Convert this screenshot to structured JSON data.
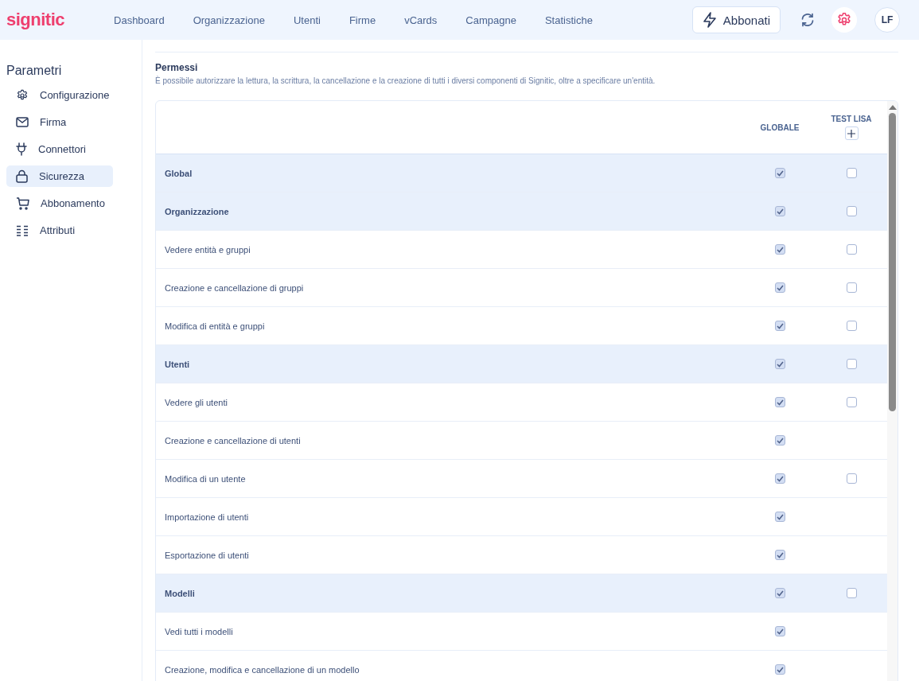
{
  "topbar": {
    "logo": "signitic",
    "nav": [
      {
        "label": "Dashboard",
        "selected": false
      },
      {
        "label": "Organizzazione",
        "selected": false
      },
      {
        "label": "Utenti",
        "selected": false
      },
      {
        "label": "Firme",
        "selected": false
      },
      {
        "label": "vCards",
        "selected": false
      },
      {
        "label": "Campagne",
        "selected": false
      },
      {
        "label": "Statistiche",
        "selected": false
      }
    ],
    "subscribe_button": "Abbonati",
    "avatar": "LF"
  },
  "sidebar": {
    "title": "Parametri",
    "items": [
      {
        "label": "Configurazione",
        "kind": "gear",
        "selected": false
      },
      {
        "label": "Firma",
        "kind": "mail",
        "selected": false
      },
      {
        "label": "Connettori",
        "kind": "plug",
        "selected": false
      },
      {
        "label": "Sicurezza",
        "kind": "lock",
        "selected": true
      },
      {
        "label": "Abbonamento",
        "kind": "cart",
        "selected": false
      },
      {
        "label": "Attributi",
        "kind": "list",
        "selected": false
      }
    ]
  },
  "permissions": {
    "title": "Permessi",
    "description": "È possibile autorizzare la lettura, la scrittura, la cancellazione e la creazione di tutti i diversi componenti di Signitic, oltre a specificare un'entità.",
    "columns": [
      "GLOBALE",
      "TEST LISA"
    ],
    "rows": [
      {
        "kind": "group",
        "label": "Global",
        "cells": [
          true,
          false
        ]
      },
      {
        "kind": "group",
        "label": "Organizzazione",
        "cells": [
          true,
          false
        ]
      },
      {
        "kind": "item",
        "label": "Vedere entità e gruppi",
        "cells": [
          true,
          false
        ]
      },
      {
        "kind": "item",
        "label": "Creazione e cancellazione di gruppi",
        "cells": [
          true,
          false
        ]
      },
      {
        "kind": "item",
        "label": "Modifica di entità e gruppi",
        "cells": [
          true,
          false
        ]
      },
      {
        "kind": "group",
        "label": "Utenti",
        "cells": [
          true,
          false
        ]
      },
      {
        "kind": "item",
        "label": "Vedere gli utenti",
        "cells": [
          true,
          false
        ]
      },
      {
        "kind": "item",
        "label": "Creazione e cancellazione di utenti",
        "cells": [
          true
        ]
      },
      {
        "kind": "item",
        "label": "Modifica di un utente",
        "cells": [
          true,
          false
        ]
      },
      {
        "kind": "item",
        "label": "Importazione di utenti",
        "cells": [
          true
        ]
      },
      {
        "kind": "item",
        "label": "Esportazione di utenti",
        "cells": [
          true
        ]
      },
      {
        "kind": "group",
        "label": "Modelli",
        "cells": [
          true,
          false
        ]
      },
      {
        "kind": "item",
        "label": "Vedi tutti i modelli",
        "cells": [
          true
        ]
      },
      {
        "kind": "item",
        "label": "Creazione, modifica e cancellazione di un modello",
        "cells": [
          true
        ]
      }
    ]
  }
}
